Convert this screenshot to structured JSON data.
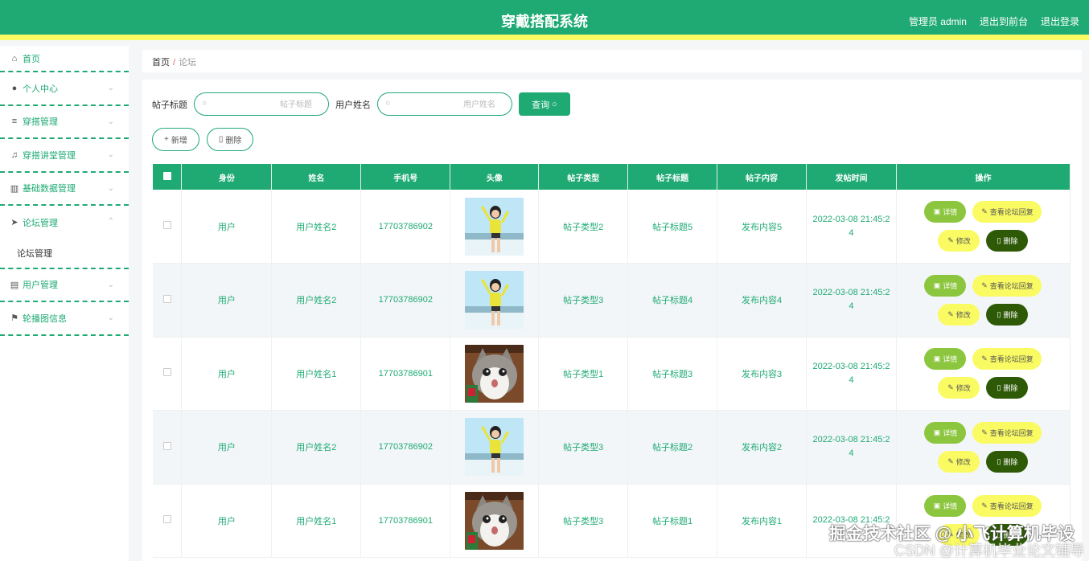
{
  "header": {
    "title": "穿戴搭配系统",
    "admin": "管理员 admin",
    "to_front": "退出到前台",
    "logout": "退出登录"
  },
  "sidebar": {
    "items": [
      {
        "label": "首页",
        "icon": "home-icon"
      },
      {
        "label": "个人中心",
        "icon": "user-icon"
      },
      {
        "label": "穿搭管理",
        "icon": "list-icon"
      },
      {
        "label": "穿搭讲堂管理",
        "icon": "bell-icon"
      },
      {
        "label": "基础数据管理",
        "icon": "chart-icon"
      },
      {
        "label": "论坛管理",
        "icon": "send-icon"
      },
      {
        "label": "用户管理",
        "icon": "card-icon"
      },
      {
        "label": "轮播图信息",
        "icon": "flag-icon"
      }
    ],
    "submenu_label": "论坛管理"
  },
  "breadcrumb": {
    "home": "首页",
    "sep": "/",
    "current": "论坛"
  },
  "search": {
    "title_label": "帖子标题",
    "title_placeholder": "帖子标题",
    "name_label": "用户姓名",
    "name_placeholder": "用户姓名",
    "query_label": "查询"
  },
  "actions": {
    "add_label": "新增",
    "delete_label": "删除"
  },
  "table": {
    "headers": [
      "身份",
      "姓名",
      "手机号",
      "头像",
      "帖子类型",
      "帖子标题",
      "帖子内容",
      "发帖时间",
      "操作"
    ],
    "rows": [
      {
        "role": "用户",
        "name": "用户姓名2",
        "phone": "17703786902",
        "avatar": "girl-photo",
        "type": "帖子类型2",
        "title": "帖子标题5",
        "content": "发布内容5",
        "time1": "2022-03-08 21:45:2",
        "time2": "4"
      },
      {
        "role": "用户",
        "name": "用户姓名2",
        "phone": "17703786902",
        "avatar": "girl-photo",
        "type": "帖子类型3",
        "title": "帖子标题4",
        "content": "发布内容4",
        "time1": "2022-03-08 21:45:2",
        "time2": "4"
      },
      {
        "role": "用户",
        "name": "用户姓名1",
        "phone": "17703786901",
        "avatar": "cat-photo",
        "type": "帖子类型1",
        "title": "帖子标题3",
        "content": "发布内容3",
        "time1": "2022-03-08 21:45:2",
        "time2": "4"
      },
      {
        "role": "用户",
        "name": "用户姓名2",
        "phone": "17703786902",
        "avatar": "girl-photo",
        "type": "帖子类型3",
        "title": "帖子标题2",
        "content": "发布内容2",
        "time1": "2022-03-08 21:45:2",
        "time2": "4"
      },
      {
        "role": "用户",
        "name": "用户姓名1",
        "phone": "17703786901",
        "avatar": "cat-photo",
        "type": "帖子类型3",
        "title": "帖子标题1",
        "content": "发布内容1",
        "time1": "2022-03-08 21:45:2",
        "time2": ""
      }
    ],
    "op_labels": {
      "detail": "详情",
      "view_reply": "查看论坛回复",
      "edit": "修改",
      "delete": "删除"
    }
  },
  "watermark": {
    "line1": "掘金技术社区 @ 小飞计算机毕设",
    "line2": "CSDN @计算机毕业论文辅导"
  },
  "colors": {
    "primary": "#1faa74",
    "accent_yellow": "#fafb63",
    "detail_green": "#8cc63f",
    "dark_green": "#2e5a07"
  }
}
